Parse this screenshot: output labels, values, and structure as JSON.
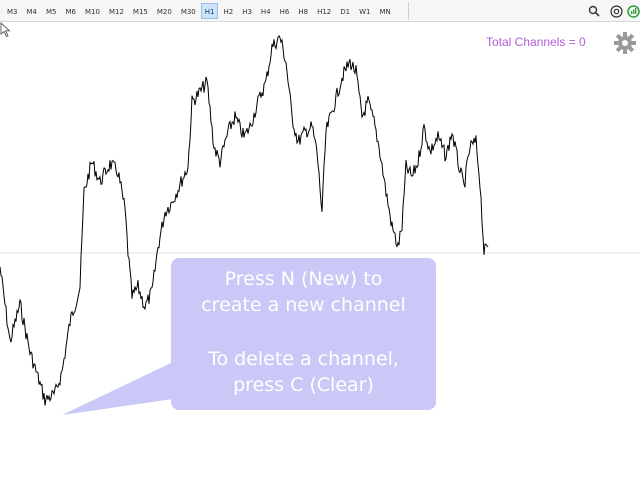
{
  "toolbar": {
    "timeframes": [
      "M3",
      "M4",
      "M5",
      "M6",
      "M10",
      "M12",
      "M15",
      "M20",
      "M30",
      "H1",
      "H2",
      "H3",
      "H4",
      "H6",
      "H8",
      "H12",
      "D1",
      "W1",
      "MN"
    ],
    "active": "H1",
    "icons": [
      "search-icon",
      "at-sign-icon",
      "signal-icon"
    ]
  },
  "chart": {
    "channels_label": "Total Channels = 0",
    "tooltip": {
      "line1": "Press N (New) to",
      "line2": "create a new channel",
      "line3": "To delete a channel,",
      "line4": "press C (Clear)"
    },
    "colors": {
      "price_line": "#000000",
      "label": "#b45cd6",
      "bubble": "#c9c8f6",
      "gear": "#9a9a9a",
      "horizontal_line": "#e2e2e2"
    }
  }
}
